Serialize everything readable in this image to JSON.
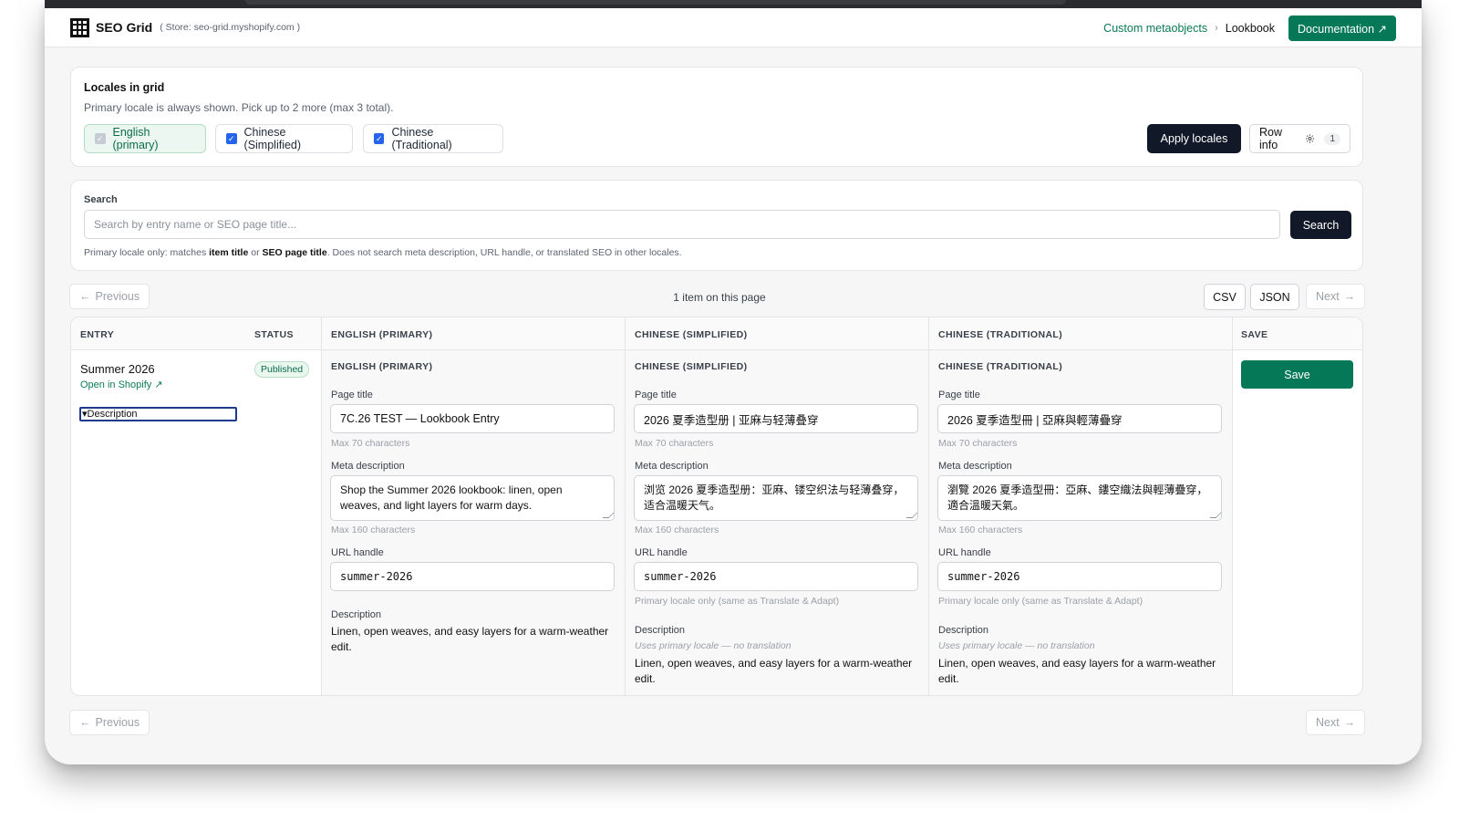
{
  "header": {
    "app_name": "SEO Grid",
    "store": "( Store: seo-grid.myshopify.com )",
    "breadcrumb_link": "Custom metaobjects",
    "breadcrumb_current": "Lookbook",
    "doc_button": "Documentation ↗"
  },
  "locales": {
    "title": "Locales in grid",
    "subtitle": "Primary locale is always shown. Pick up to 2 more (max 3 total).",
    "options": [
      {
        "label": "English (primary)",
        "checked": true,
        "disabled": true
      },
      {
        "label": "Chinese (Simplified)",
        "checked": true
      },
      {
        "label": "Chinese (Traditional)",
        "checked": true
      }
    ],
    "apply_button": "Apply locales",
    "row_info_button": "Row info",
    "row_info_count": "1"
  },
  "search": {
    "label": "Search",
    "placeholder": "Search by entry name or SEO page title...",
    "button": "Search",
    "hint_prefix": "Primary locale only: matches ",
    "hint_b1": "item title",
    "hint_mid": " or ",
    "hint_b2": "SEO page title",
    "hint_suffix": ". Does not search meta description, URL handle, or translated SEO in other locales."
  },
  "pagination": {
    "previous": "Previous",
    "next": "Next",
    "count": "1 item on this page",
    "csv": "CSV",
    "json": "JSON"
  },
  "table": {
    "columns": [
      "ENTRY",
      "STATUS",
      "ENGLISH (PRIMARY)",
      "CHINESE (SIMPLIFIED)",
      "CHINESE (TRADITIONAL)",
      "SAVE"
    ],
    "row": {
      "entry_name": "Summer 2026",
      "open_link": "Open in Shopify ↗",
      "description_toggle": "Description",
      "status": "Published",
      "save_button": "Save"
    },
    "labels": {
      "page_title": "Page title",
      "page_title_help": "Max 70 characters",
      "meta_description": "Meta description",
      "meta_help": "Max 160 characters",
      "url_handle": "URL handle",
      "url_help_secondary": "Primary locale only (same as Translate & Adapt)",
      "description": "Description",
      "description_help_secondary": "Uses primary locale — no translation"
    },
    "locales": [
      {
        "heading": "ENGLISH (PRIMARY)",
        "page_title": "7C.26 TEST — Lookbook Entry",
        "meta_description": "Shop the Summer 2026 lookbook: linen, open weaves, and light layers for warm days.",
        "url_handle": "summer-2026",
        "description": "Linen, open weaves, and easy layers for a warm-weather edit."
      },
      {
        "heading": "CHINESE (SIMPLIFIED)",
        "page_title": "2026 夏季造型册 | 亚麻与轻薄叠穿",
        "meta_description": "浏览 2026 夏季造型册：亚麻、镂空织法与轻薄叠穿，适合温暖天气。",
        "url_handle": "summer-2026",
        "description": "Linen, open weaves, and easy layers for a warm-weather edit."
      },
      {
        "heading": "CHINESE (TRADITIONAL)",
        "page_title": "2026 夏季造型冊 | 亞麻與輕薄疊穿",
        "meta_description": "瀏覽 2026 夏季造型冊：亞麻、鏤空織法與輕薄疊穿，適合溫暖天氣。",
        "url_handle": "summer-2026",
        "description": "Linen, open weaves, and easy layers for a warm-weather edit."
      }
    ]
  },
  "colors": {
    "accent_green": "#047857",
    "dark_button": "#111827",
    "checkbox_blue": "#2563eb"
  }
}
